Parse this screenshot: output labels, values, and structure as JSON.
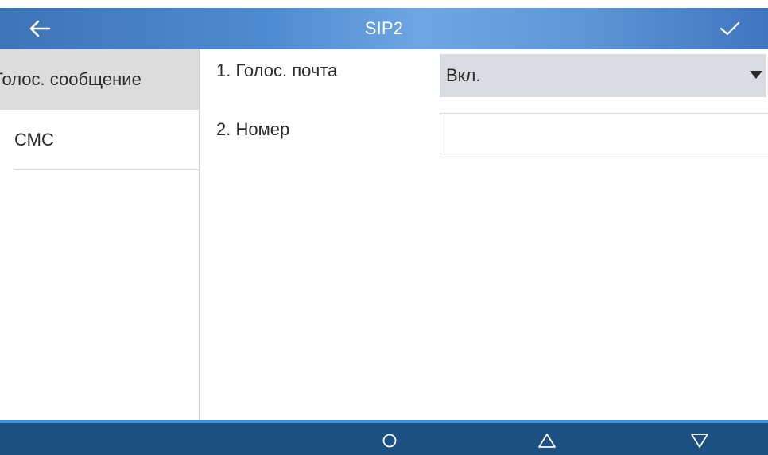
{
  "header": {
    "title": "SIP2",
    "back_icon": "arrow-left-icon",
    "confirm_icon": "checkmark-icon"
  },
  "sidebar": {
    "items": [
      {
        "label": "Голос. сообщение",
        "active": true
      },
      {
        "label": "СМС",
        "active": false
      }
    ]
  },
  "form": {
    "voicemail": {
      "label": "1. Голос. почта",
      "value": "Вкл."
    },
    "number": {
      "label": "2. Номер",
      "value": ""
    }
  },
  "navbar": {
    "icons": [
      "circle-icon",
      "triangle-up-icon",
      "triangle-down-icon"
    ]
  },
  "colors": {
    "header": "#4f8bd0",
    "navbar": "#1c4f82",
    "selected": "#dcdcdc",
    "select_bg": "#d9dde2"
  }
}
